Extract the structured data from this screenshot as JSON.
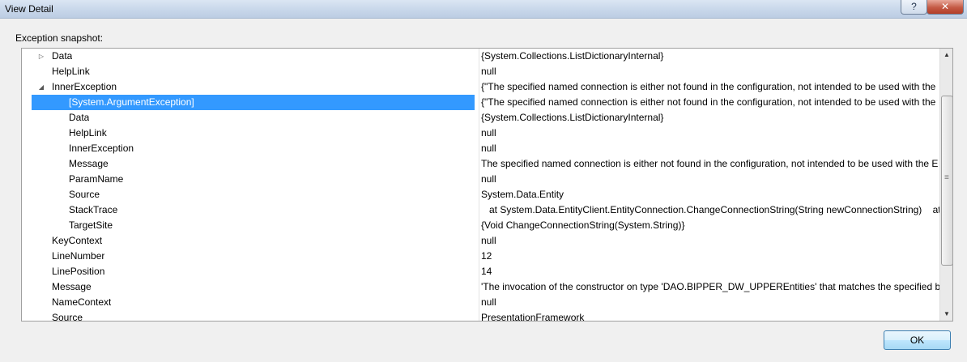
{
  "window": {
    "title": "View Detail",
    "help_label": "?",
    "close_label": "✕"
  },
  "panel": {
    "label": "Exception snapshot:"
  },
  "rows": [
    {
      "name": "Data",
      "value": "{System.Collections.ListDictionaryInternal}",
      "toggle": "▷"
    },
    {
      "name": "HelpLink",
      "value": "null"
    },
    {
      "name": "InnerException",
      "value": "{\"The specified named connection is either not found in the configuration, not intended to be used with the",
      "toggle": "◢"
    },
    {
      "name": "[System.ArgumentException]",
      "value": "{\"The specified named connection is either not found in the configuration, not intended to be used with the"
    },
    {
      "name": "Data",
      "value": "{System.Collections.ListDictionaryInternal}"
    },
    {
      "name": "HelpLink",
      "value": "null"
    },
    {
      "name": "InnerException",
      "value": "null"
    },
    {
      "name": "Message",
      "value": "The specified named connection is either not found in the configuration, not intended to be used with the E"
    },
    {
      "name": "ParamName",
      "value": "null"
    },
    {
      "name": "Source",
      "value": "System.Data.Entity"
    },
    {
      "name": "StackTrace",
      "value": "   at System.Data.EntityClient.EntityConnection.ChangeConnectionString(String newConnectionString)    at Sy"
    },
    {
      "name": "TargetSite",
      "value": "{Void ChangeConnectionString(System.String)}"
    },
    {
      "name": "KeyContext",
      "value": "null"
    },
    {
      "name": "LineNumber",
      "value": "12"
    },
    {
      "name": "LinePosition",
      "value": "14"
    },
    {
      "name": "Message",
      "value": "'The invocation of the constructor on type 'DAO.BIPPER_DW_UPPEREntities' that matches the specified bind"
    },
    {
      "name": "NameContext",
      "value": "null"
    },
    {
      "name": "Source",
      "value": "PresentationFramework"
    }
  ],
  "selected_row": 3,
  "icons": {
    "scroll_up": "scroll-up-arrow-icon",
    "scroll_down": "scroll-down-arrow-icon",
    "expand": "expand-triangle-icon",
    "collapse": "collapse-triangle-icon"
  },
  "ok_button": {
    "label": "OK"
  }
}
